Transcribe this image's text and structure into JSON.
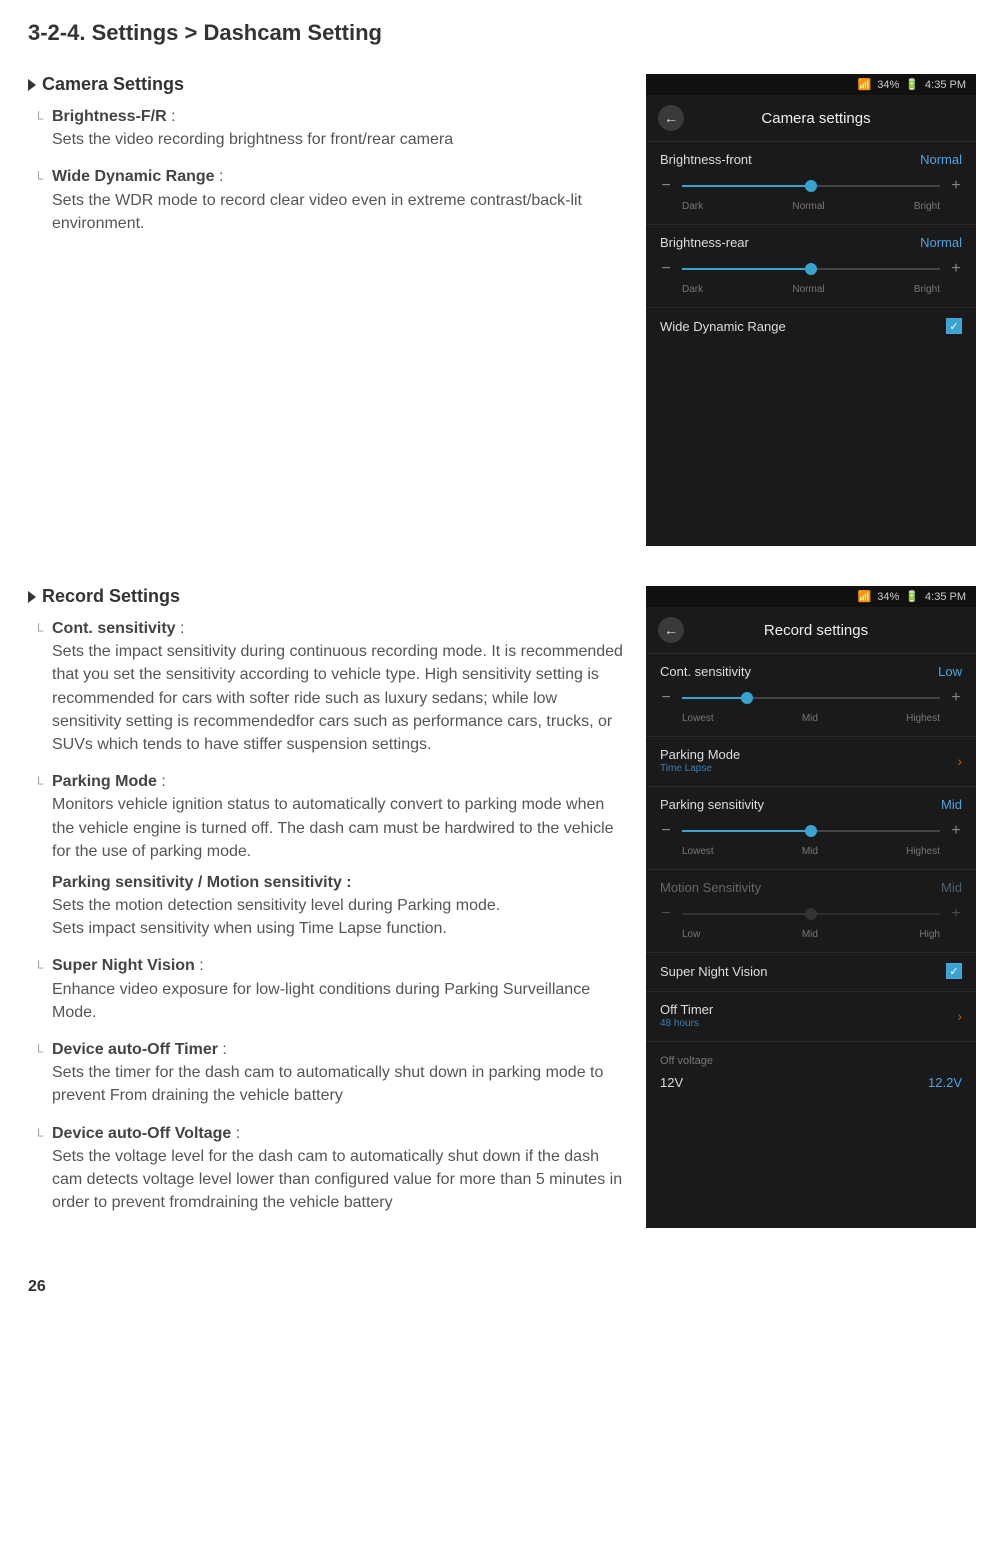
{
  "page_title_prefix": "3-2-4. Settings",
  "page_title_sep": " > ",
  "page_title_suffix": "Dashcam Setting",
  "page_number": "26",
  "camera_section": {
    "heading": "Camera Settings",
    "items": [
      {
        "label": "Brightness-F/R",
        "desc": "Sets the video recording brightness for front/rear camera"
      },
      {
        "label": "Wide Dynamic Range",
        "desc": "Sets the WDR mode to record clear video even in extreme contrast/back-lit environment."
      }
    ],
    "phone": {
      "status_battery": "34%",
      "status_time": "4:35 PM",
      "appbar_title": "Camera settings",
      "brightness_front": {
        "name": "Brightness-front",
        "value": "Normal",
        "ticks": [
          "Dark",
          "Normal",
          "Bright"
        ],
        "pos": 50
      },
      "brightness_rear": {
        "name": "Brightness-rear",
        "value": "Normal",
        "ticks": [
          "Dark",
          "Normal",
          "Bright"
        ],
        "pos": 50
      },
      "wdr": {
        "name": "Wide Dynamic Range",
        "checked": true
      }
    }
  },
  "record_section": {
    "heading": "Record Settings",
    "items": [
      {
        "label": "Cont. sensitivity",
        "desc": "Sets the impact sensitivity during continuous recording mode.  It is recommended that you set the sensitivity according to vehicle type.  High sensitivity setting is recommended for cars with softer ride such as luxury sedans; while low sensitivity setting is recommendedfor cars such as performance cars, trucks, or SUVs which tends to have stiffer suspension settings."
      },
      {
        "label": "Parking Mode",
        "desc": "Monitors vehicle ignition status to automatically convert to parking mode when the vehicle engine is turned off.  The dash cam must be hardwired to the vehicle for the use of parking mode.",
        "sublabel": "Parking sensitivity / Motion sensitivity :",
        "subdesc1": "Sets the motion detection sensitivity level during Parking mode.",
        "subdesc2": "Sets impact sensitivity when using Time Lapse function."
      },
      {
        "label": "Super Night Vision",
        "desc": "Enhance video exposure for low-light conditions during Parking Surveillance Mode."
      },
      {
        "label": "Device auto-Off Timer",
        "desc": "Sets the timer for the dash cam to automatically shut down in parking mode to prevent From draining the vehicle battery"
      },
      {
        "label": "Device auto-Off  Voltage",
        "desc": "Sets the voltage level for the dash cam to automatically shut down if the dash cam detects voltage level lower than configured value for more than 5 minutes in order to prevent fromdraining the vehicle battery"
      }
    ],
    "phone": {
      "status_battery": "34%",
      "status_time": "4:35 PM",
      "appbar_title": "Record settings",
      "cont_sens": {
        "name": "Cont. sensitivity",
        "value": "Low",
        "ticks": [
          "Lowest",
          "Mid",
          "Highest"
        ],
        "pos": 25
      },
      "parking_mode": {
        "name": "Parking Mode",
        "sub": "Time Lapse"
      },
      "parking_sens": {
        "name": "Parking sensitivity",
        "value": "Mid",
        "ticks": [
          "Lowest",
          "Mid",
          "Highest"
        ],
        "pos": 50
      },
      "motion_sens": {
        "name": "Motion Sensitivity",
        "value": "Mid",
        "ticks": [
          "Low",
          "Mid",
          "High"
        ],
        "pos": 50,
        "dim": true
      },
      "snv": {
        "name": "Super Night Vision",
        "checked": true
      },
      "off_timer": {
        "name": "Off Timer",
        "sub": "48 hours"
      },
      "off_voltage": {
        "name": "Off voltage"
      },
      "volt_row": {
        "name": "12V",
        "value": "12.2V"
      }
    }
  }
}
